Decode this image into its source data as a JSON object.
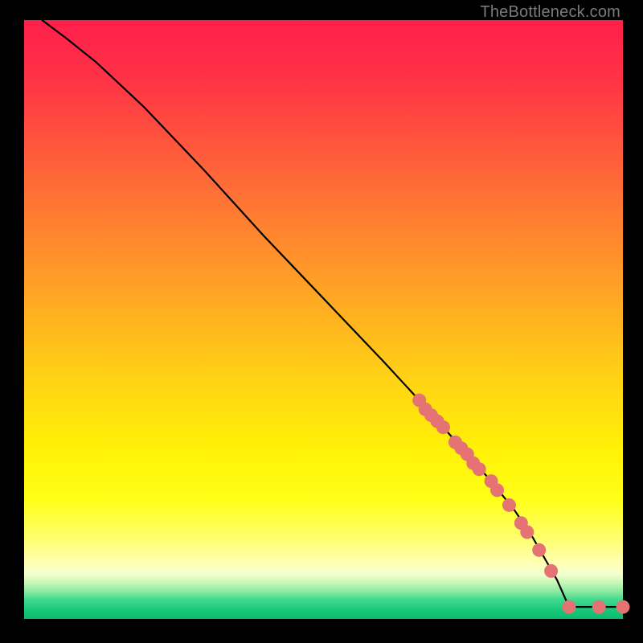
{
  "watermark": "TheBottleneck.com",
  "colors": {
    "point_fill": "#e57373",
    "point_stroke": "#c94f4f",
    "curve_stroke": "#000000"
  },
  "chart_data": {
    "type": "line",
    "title": "",
    "xlabel": "",
    "ylabel": "",
    "xlim": [
      0,
      100
    ],
    "ylim": [
      0,
      100
    ],
    "grid": false,
    "legend": false,
    "series": [
      {
        "name": "curve",
        "x": [
          3,
          7,
          12,
          20,
          30,
          40,
          50,
          60,
          66,
          70,
          74,
          78,
          82,
          85,
          87,
          89,
          91,
          96,
          100
        ],
        "y": [
          100,
          97,
          93,
          85.5,
          75,
          64,
          53.5,
          43,
          36.5,
          32,
          27.5,
          23,
          18,
          13.5,
          10,
          6.5,
          2,
          2,
          2
        ]
      }
    ],
    "points": [
      {
        "x": 66,
        "y": 36.5
      },
      {
        "x": 67,
        "y": 35
      },
      {
        "x": 68,
        "y": 34
      },
      {
        "x": 69,
        "y": 33
      },
      {
        "x": 70,
        "y": 32
      },
      {
        "x": 72,
        "y": 29.5
      },
      {
        "x": 73,
        "y": 28.5
      },
      {
        "x": 74,
        "y": 27.5
      },
      {
        "x": 75,
        "y": 26
      },
      {
        "x": 76,
        "y": 25
      },
      {
        "x": 78,
        "y": 23
      },
      {
        "x": 79,
        "y": 21.5
      },
      {
        "x": 81,
        "y": 19
      },
      {
        "x": 83,
        "y": 16
      },
      {
        "x": 84,
        "y": 14.5
      },
      {
        "x": 86,
        "y": 11.5
      },
      {
        "x": 88,
        "y": 8
      },
      {
        "x": 91,
        "y": 2
      },
      {
        "x": 96,
        "y": 2
      },
      {
        "x": 100,
        "y": 2
      }
    ]
  }
}
